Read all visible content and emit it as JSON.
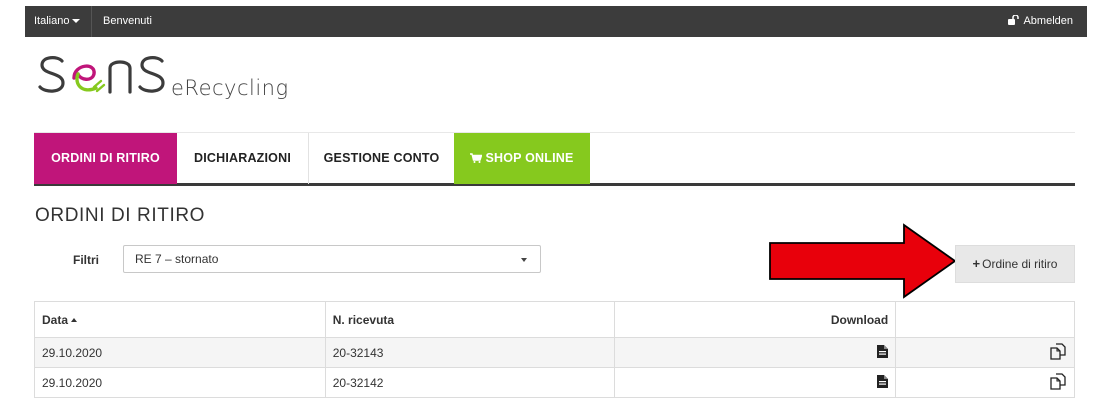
{
  "topbar": {
    "language": "Italiano",
    "welcome": "Benvenuti",
    "logout": "Abmelden"
  },
  "logo": {
    "brand": "S  NS",
    "sub": "eRecycling",
    "colors": {
      "pink": "#c0157a",
      "green": "#86c91e",
      "dark": "#3c3c3c"
    }
  },
  "nav": {
    "tabs": [
      {
        "label": "ORDINI DI RITIRO",
        "active": true
      },
      {
        "label": "DICHIARAZIONI"
      },
      {
        "label": "GESTIONE CONTO"
      },
      {
        "label": "SHOP ONLINE",
        "icon": "cart-icon"
      }
    ]
  },
  "page": {
    "title": "ORDINI DI RITIRO",
    "filter_label": "Filtri",
    "filter_value": "RE 7 – stornato",
    "add_button": "Ordine di ritiro"
  },
  "table": {
    "headers": {
      "date": "Data",
      "number": "N. ricevuta",
      "download": "Download",
      "actions": ""
    },
    "rows": [
      {
        "date": "29.10.2020",
        "number": "20-32143"
      },
      {
        "date": "29.10.2020",
        "number": "20-32142"
      }
    ]
  },
  "annotation": {
    "arrow_color": "#e8000b"
  }
}
